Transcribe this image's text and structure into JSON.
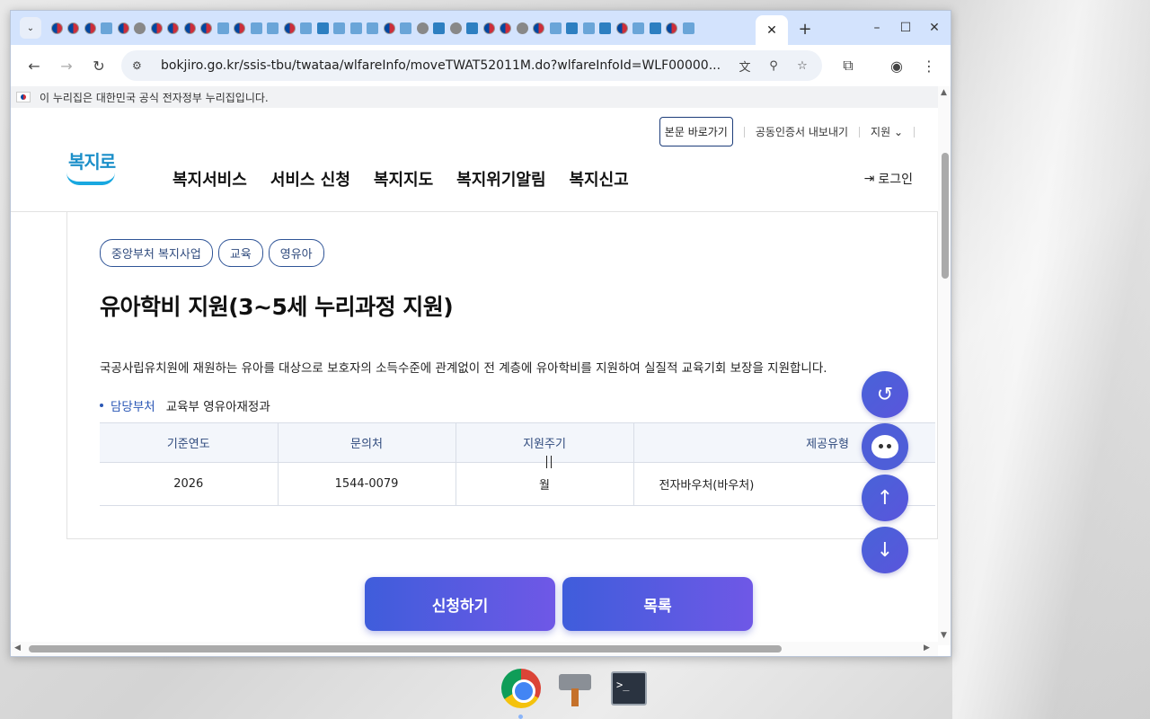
{
  "browser": {
    "active_tab_close": "✕",
    "new_tab": "+",
    "url": "bokjiro.go.kr/ssis-tbu/twataa/wlfareInfo/moveTWAT52011M.do?wlfareInfoId=WLF00000...",
    "window_controls": {
      "minimize": "–",
      "maximize": "☐",
      "close": "✕"
    }
  },
  "page": {
    "gov_banner": "이 누리집은 대한민국 공식 전자정부 누리집입니다.",
    "util": {
      "skip": "본문 바로가기",
      "cert": "공동인증서 내보내기",
      "support": "지원 ⌄"
    },
    "logo_text": "복지로",
    "menu": [
      "복지서비스",
      "서비스 신청",
      "복지지도",
      "복지위기알림",
      "복지신고"
    ],
    "login": "로그인",
    "chips": [
      "중앙부처 복지사업",
      "교육",
      "영유아"
    ],
    "title": "유아학비 지원(3~5세 누리과정 지원)",
    "description": "국공사립유치원에 재원하는 유아를 대상으로 보호자의 소득수준에 관계없이 전 계층에 유아학비를 지원하여 실질적 교육기회 보장을 지원합니다.",
    "dept_label": "담당부처",
    "dept_value": "교육부 영유아재정과",
    "table": {
      "headers": [
        "기준연도",
        "문의처",
        "지원주기",
        "제공유형"
      ],
      "row": [
        "2026",
        "1544-0079",
        "월",
        "전자바우처(바우처)"
      ]
    },
    "buttons": {
      "apply": "신청하기",
      "list": "목록"
    }
  }
}
